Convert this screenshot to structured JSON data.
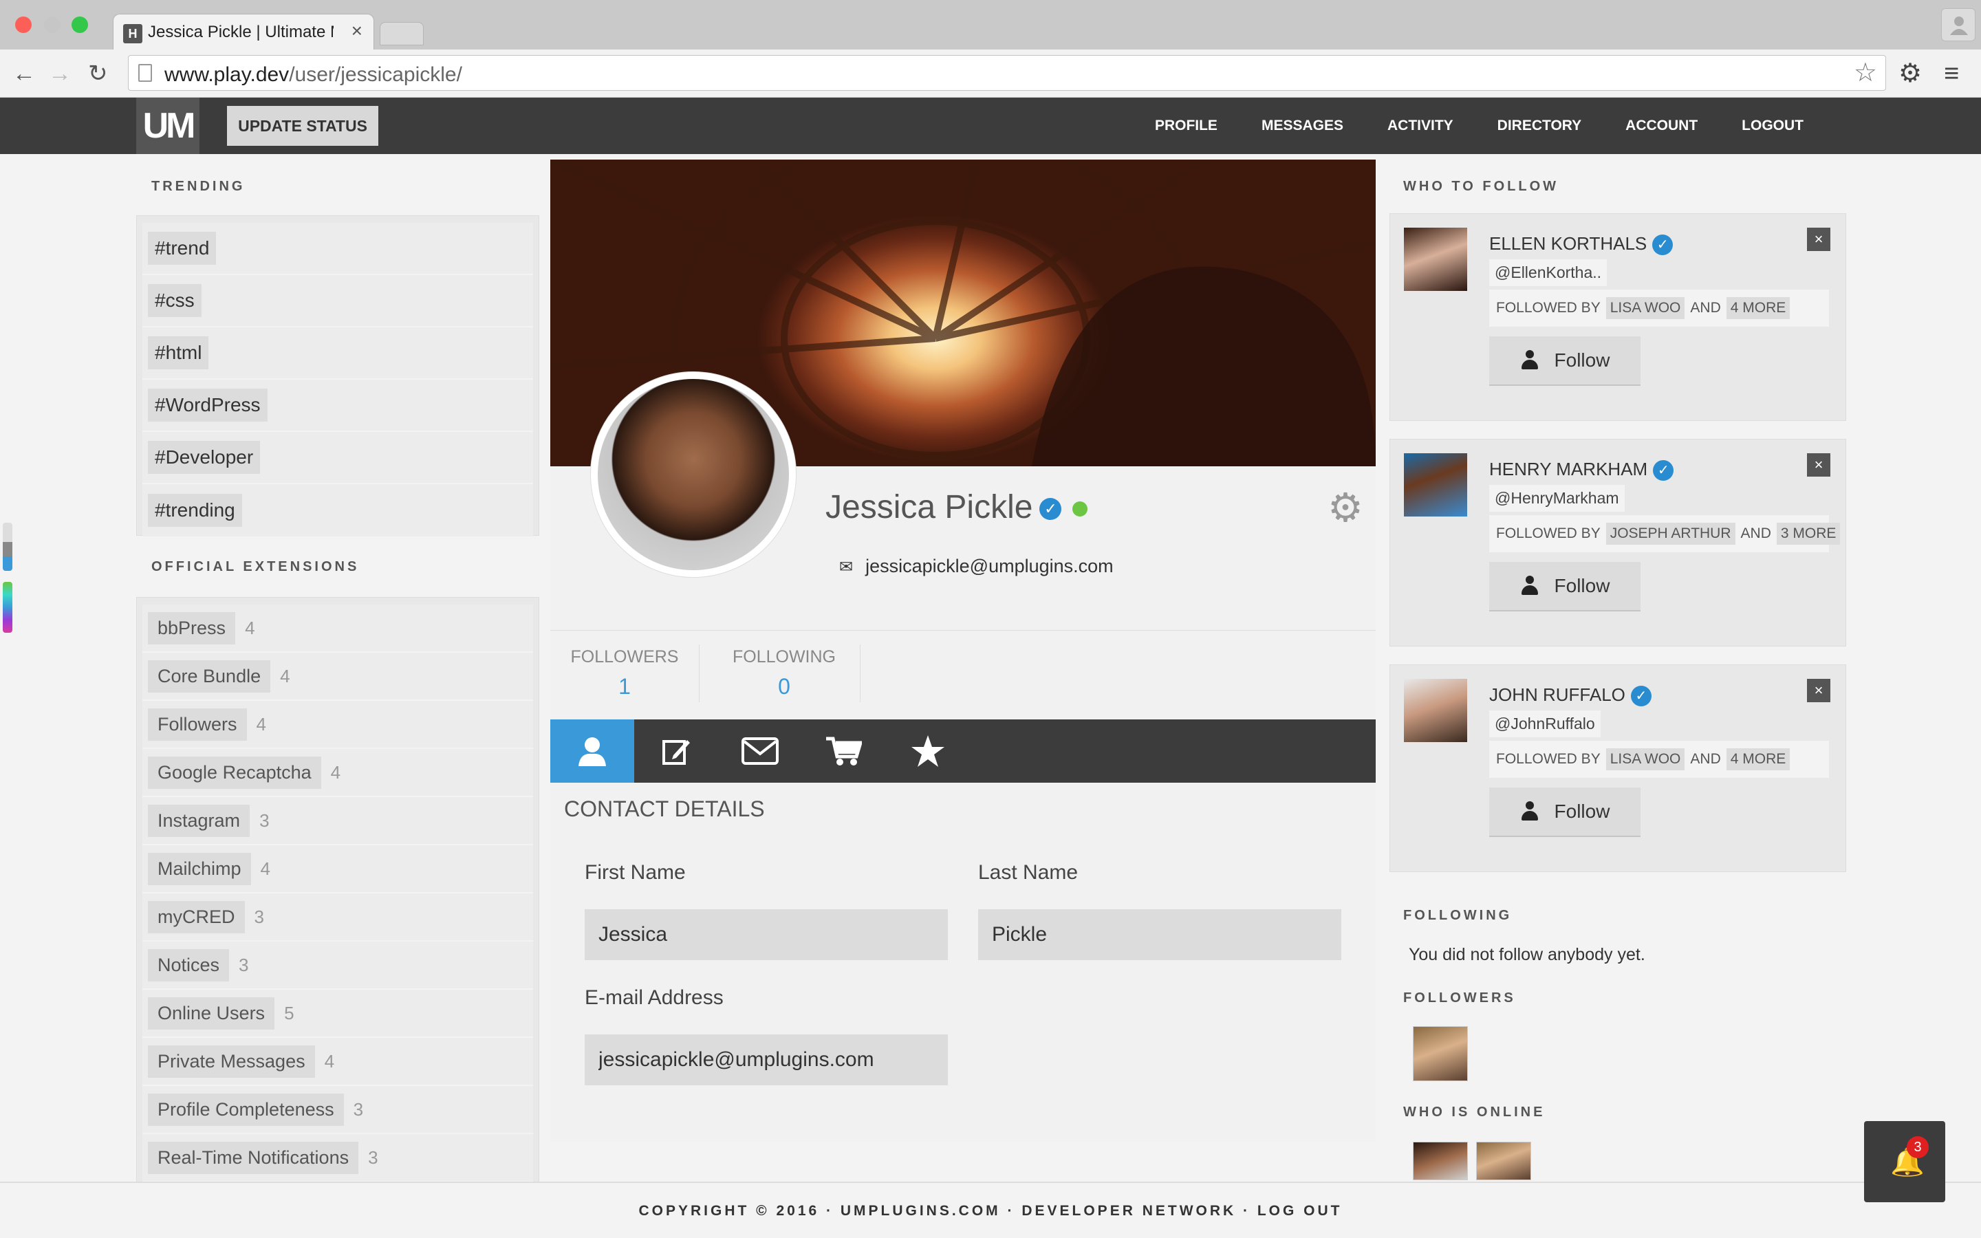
{
  "browser": {
    "tab_title": "Jessica Pickle | Ultimate M",
    "tab_favicon": "H",
    "url_domain": "www.play.dev",
    "url_path": "/user/jessicapickle/"
  },
  "header": {
    "logo": "UM",
    "update_status": "UPDATE STATUS",
    "nav": [
      "PROFILE",
      "MESSAGES",
      "ACTIVITY",
      "DIRECTORY",
      "ACCOUNT",
      "LOGOUT"
    ]
  },
  "trending": {
    "heading": "TRENDING",
    "tags": [
      "#trend",
      "#css",
      "#html",
      "#WordPress",
      "#Developer",
      "#trending"
    ]
  },
  "extensions": {
    "heading": "OFFICIAL EXTENSIONS",
    "items": [
      {
        "name": "bbPress",
        "count": "4"
      },
      {
        "name": "Core Bundle",
        "count": "4"
      },
      {
        "name": "Followers",
        "count": "4"
      },
      {
        "name": "Google Recaptcha",
        "count": "4"
      },
      {
        "name": "Instagram",
        "count": "3"
      },
      {
        "name": "Mailchimp",
        "count": "4"
      },
      {
        "name": "myCRED",
        "count": "3"
      },
      {
        "name": "Notices",
        "count": "3"
      },
      {
        "name": "Online Users",
        "count": "5"
      },
      {
        "name": "Private Messages",
        "count": "4"
      },
      {
        "name": "Profile Completeness",
        "count": "3"
      },
      {
        "name": "Real-Time Notifications",
        "count": "3"
      }
    ]
  },
  "profile": {
    "name": "Jessica Pickle",
    "email": "jessicapickle@umplugins.com",
    "followers_label": "FOLLOWERS",
    "followers_count": "1",
    "following_label": "FOLLOWING",
    "following_count": "0",
    "contact_title": "CONTACT DETAILS",
    "first_name_label": "First Name",
    "first_name": "Jessica",
    "last_name_label": "Last Name",
    "last_name": "Pickle",
    "email_label": "E-mail Address"
  },
  "who_to_follow": {
    "heading": "WHO TO FOLLOW",
    "followed_by_label": "FOLLOWED BY",
    "and_label": "AND",
    "follow_label": "Follow",
    "users": [
      {
        "name": "ELLEN KORTHALS",
        "handle": "@EllenKortha..",
        "followed_by": "LISA WOO",
        "more": "4 MORE"
      },
      {
        "name": "HENRY MARKHAM",
        "handle": "@HenryMarkham",
        "followed_by": "JOSEPH ARTHUR",
        "more": "3 MORE"
      },
      {
        "name": "JOHN RUFFALO",
        "handle": "@JohnRuffalo",
        "followed_by": "LISA WOO",
        "more": "4 MORE"
      }
    ]
  },
  "following": {
    "heading": "FOLLOWING",
    "empty_text": "You did not follow anybody yet."
  },
  "followers": {
    "heading": "FOLLOWERS"
  },
  "online": {
    "heading": "WHO IS ONLINE"
  },
  "footer": {
    "text": "COPYRIGHT © 2016 · UMPLUGINS.COM · DEVELOPER NETWORK · LOG OUT"
  },
  "notifications": {
    "count": "3"
  },
  "colors": {
    "accent": "#3a9ad9",
    "header_bg": "#3c3c3c",
    "verified": "#2a8cd0",
    "online": "#6cc644",
    "badge": "#e02020"
  }
}
